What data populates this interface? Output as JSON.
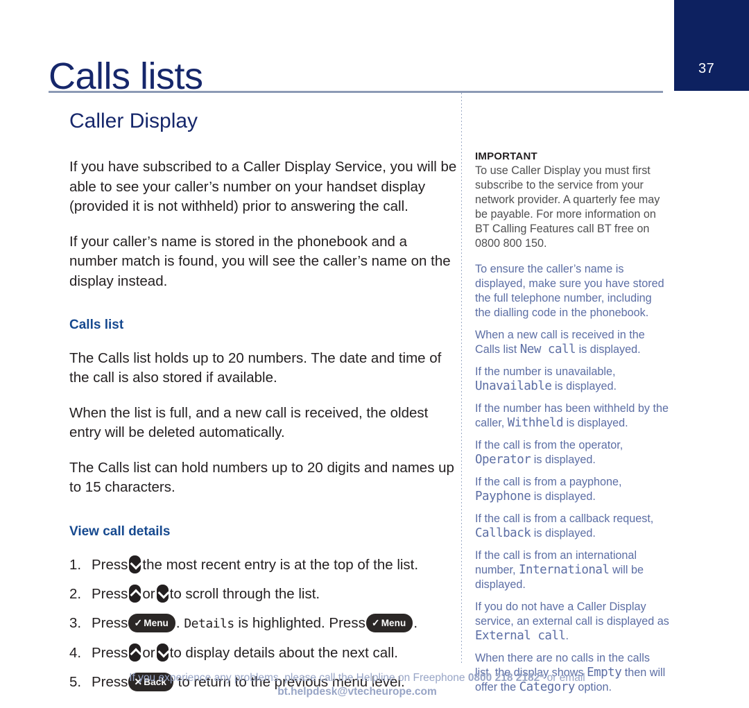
{
  "page": {
    "number": "37",
    "chapter_title": "Calls lists",
    "badge_color": "#0d2160"
  },
  "left": {
    "section_title": "Caller Display",
    "paragraphs": [
      "If you have subscribed to a Caller Display Service, you will be able to see your caller’s number on your handset display (provided it is not withheld) prior to answering the call.",
      "If your caller’s name is stored in the phonebook and a number match is found, you will see the caller’s name on the display instead."
    ],
    "calls_list_heading": "Calls list",
    "calls_list_paragraphs": [
      "The Calls list holds up to 20 numbers. The date and time of the call is also stored if available.",
      "When the list is full, and a new call is received, the oldest entry will be deleted automatically.",
      "The Calls list can hold numbers up to 20 digits and names up to 15 characters."
    ],
    "view_call_details_heading": "View call details",
    "steps": [
      {
        "num": "1.",
        "press_label": "Press",
        "keys": [
          "down"
        ],
        "tail": "the most recent entry is at the top of the list."
      },
      {
        "num": "2.",
        "press_label": "Press",
        "keys": [
          "up",
          "down"
        ],
        "or_label": "or",
        "tail": "to scroll through the list."
      },
      {
        "num": "3.",
        "press_label": "Press",
        "menu_label": "Menu",
        "menu_symbol": "✓",
        "mid_lcd": "Details",
        "mid_text": "is highlighted. Press",
        "tail": "."
      },
      {
        "num": "4.",
        "press_label": "Press",
        "keys": [
          "up",
          "down"
        ],
        "or_label": "or",
        "tail": "to display details about the next call."
      },
      {
        "num": "5.",
        "press_label": "Press",
        "back_label": "Back",
        "back_symbol": "✕",
        "tail": "to return to the previous menu level."
      }
    ]
  },
  "right": {
    "important_label": "IMPORTANT",
    "important_text": "To use Caller Display you must first subscribe to the service from your network provider.  A quarterly fee may be payable.  For more information on BT Calling Features call BT free on 0800 800 150.",
    "notes": [
      {
        "before": "To ensure the caller’s name is displayed, make sure you have stored the full telephone number, including the dialling code in the phonebook.",
        "lcd": "",
        "after": ""
      },
      {
        "before": "When a new call is received in the Calls list",
        "lcd": "New call",
        "after": "is displayed."
      },
      {
        "before": "If the number is unavailable,",
        "lcd": "Unavailable",
        "after": "is displayed."
      },
      {
        "before": "If the number has been withheld by the caller,",
        "lcd": "Withheld",
        "after": "is displayed."
      },
      {
        "before": "If the call is from the operator,",
        "lcd": "Operator",
        "after": "is displayed."
      },
      {
        "before": "If the call is from a payphone,",
        "lcd": "Payphone",
        "after": "is displayed."
      },
      {
        "before": "If the call is from a callback request,",
        "lcd": "Callback",
        "after": "is displayed."
      },
      {
        "before": "If the call is from an international number,",
        "lcd": "International",
        "after": "will be displayed."
      },
      {
        "before": "If you do not have a Caller Display service, an external call is displayed as",
        "lcd": "External call",
        "after": "."
      },
      {
        "before": "When there are no calls in the calls list, the display shows",
        "lcd": "Empty",
        "after": "then will offer the",
        "lcd2": "Category",
        "after2": "option."
      }
    ]
  },
  "footer": {
    "lead": "If you experience any problems, please call the Helpline on Freephone",
    "phone": "0800 218 2182*",
    "middle": "or email",
    "email": "bt.helpdesk@vtecheurope.com"
  }
}
